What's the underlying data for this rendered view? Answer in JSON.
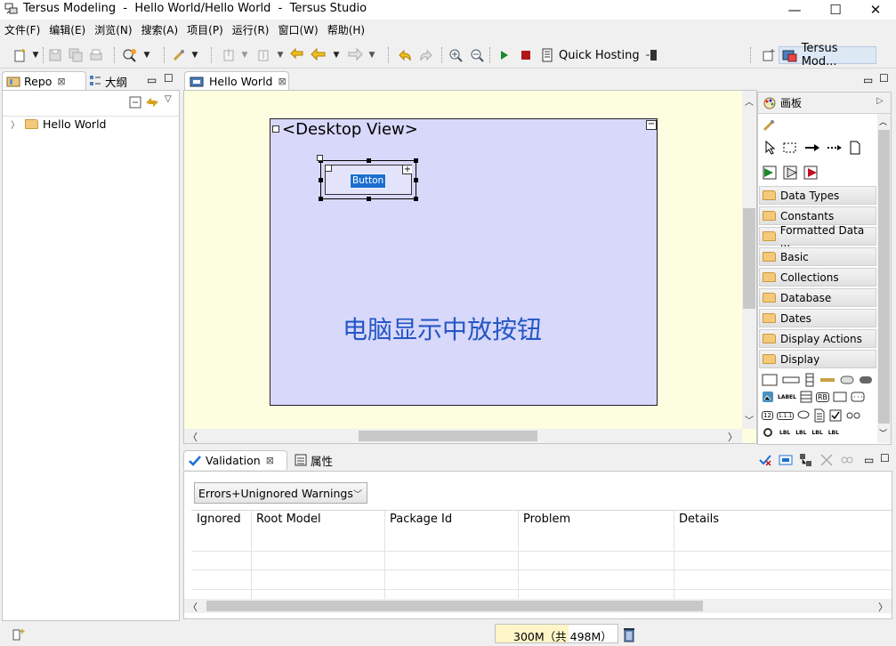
{
  "window": {
    "title": "Tersus Modeling  -  Hello World/Hello World  -  Tersus Studio",
    "minimize": "—",
    "maximize": "☐",
    "close": "✕"
  },
  "menu": [
    "文件(F)",
    "编辑(E)",
    "浏览(N)",
    "搜索(A)",
    "项目(P)",
    "运行(R)",
    "窗口(W)",
    "帮助(H)"
  ],
  "toolbar": {
    "quick_hosting": "Quick Hosting",
    "perspective": "Tersus Mod..."
  },
  "left_panel": {
    "tabs": [
      {
        "label": "Repo"
      },
      {
        "label": "大纲"
      }
    ],
    "tree": [
      {
        "label": "Hello World"
      }
    ]
  },
  "editor": {
    "tab_label": "Hello World",
    "desktop_view_label": "<Desktop View>",
    "button_label": "Button",
    "annotation": "电脑显示中放按钮"
  },
  "palette": {
    "title": "画板",
    "drawers": [
      "Data Types",
      "Constants",
      "Formatted Data ...",
      "Basic",
      "Collections",
      "Database",
      "Dates",
      "Display Actions",
      "Display"
    ],
    "mini_labels": [
      "LABEL",
      "RB",
      "12",
      "1.1.1",
      "LBL",
      "LBL",
      "LBL",
      "LBL"
    ]
  },
  "bottom_panel": {
    "tabs": [
      {
        "label": "Validation"
      },
      {
        "label": "属性"
      }
    ],
    "filter": "Errors+Unignored Warnings",
    "columns": [
      "Ignored",
      "Root Model",
      "Package Id",
      "Problem",
      "Details"
    ]
  },
  "status": {
    "memory": "300M（共 498M）",
    "memory_used_fraction": 0.6
  },
  "colors": {
    "canvas_bg": "#fdfde0",
    "desktop_view_bg": "#d8d8fb",
    "annotation": "#2457c5",
    "selection": "#1b6fd1"
  }
}
